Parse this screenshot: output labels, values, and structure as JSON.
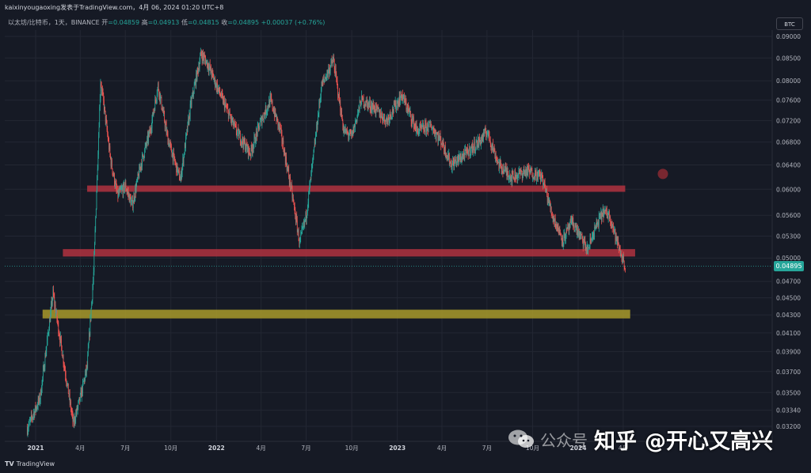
{
  "header": {
    "caption": "kaixinyougaoxing发表于TradingView.com，4月 06, 2024 01:20 UTC+8"
  },
  "legend": {
    "symbol": "以太坊/比特币，1天，BINANCE",
    "open_label": "开",
    "open_value": "=0.04859",
    "high_label": "高",
    "high_value": "=0.04913",
    "low_label": "低",
    "low_value": "=0.04815",
    "close_label": "收",
    "close_value": "=0.04895",
    "change": "+0.00037 (+0.76%)"
  },
  "currency_tag": "BTC",
  "current_price": "0.04895",
  "footer": {
    "logo_mark": "TV",
    "logo_text": "TradingView"
  },
  "watermark": {
    "wechat": "公众号",
    "prefix": "知乎",
    "at": "@开心又高兴"
  },
  "colors": {
    "background": "#161a25",
    "up": "#26a69a",
    "down": "#ef5350",
    "resistance_zone": "#b0323f",
    "support_zone": "#a89a2a"
  },
  "chart_data": {
    "type": "candlestick",
    "symbol": "以太坊/比特币",
    "interval": "1天",
    "exchange": "BINANCE",
    "ylim": [
      0.0315,
      0.0905
    ],
    "y_ticks": [
      0.09,
      0.085,
      0.08,
      0.076,
      0.072,
      0.068,
      0.064,
      0.06,
      0.056,
      0.053,
      0.05,
      0.047,
      0.045,
      0.043,
      0.041,
      0.039,
      0.037,
      0.035,
      0.0334,
      0.032
    ],
    "y_tick_labels": [
      "0.09000",
      "0.08500",
      "0.08000",
      "0.07600",
      "0.07200",
      "0.06800",
      "0.06400",
      "0.06000",
      "0.05600",
      "0.05300",
      "0.05000",
      "0.04700",
      "0.04500",
      "0.04300",
      "0.04100",
      "0.03900",
      "0.03700",
      "0.03500",
      "0.03340",
      "0.03200"
    ],
    "x_ticks": [
      "2021-01",
      "2021-04",
      "2021-07",
      "2021-10",
      "2022-01",
      "2022-04",
      "2022-07",
      "2022-10",
      "2023-01",
      "2023-04",
      "2023-07",
      "2023-10",
      "2024-01",
      "2024-04"
    ],
    "x_tick_labels": [
      "2021",
      "4月",
      "7月",
      "10月",
      "2022",
      "4月",
      "7月",
      "10月",
      "2023",
      "4月",
      "7月",
      "10月",
      "2024",
      "4月"
    ],
    "close_path": [
      [
        "2020-12-15",
        0.0318
      ],
      [
        "2021-01-10",
        0.0345
      ],
      [
        "2021-02-05",
        0.0455
      ],
      [
        "2021-02-25",
        0.0385
      ],
      [
        "2021-03-18",
        0.0322
      ],
      [
        "2021-04-01",
        0.0345
      ],
      [
        "2021-04-15",
        0.0375
      ],
      [
        "2021-04-28",
        0.048
      ],
      [
        "2021-05-12",
        0.08
      ],
      [
        "2021-05-20",
        0.074
      ],
      [
        "2021-06-01",
        0.065
      ],
      [
        "2021-06-15",
        0.059
      ],
      [
        "2021-07-01",
        0.0605
      ],
      [
        "2021-07-15",
        0.0575
      ],
      [
        "2021-08-01",
        0.064
      ],
      [
        "2021-08-20",
        0.07
      ],
      [
        "2021-09-05",
        0.079
      ],
      [
        "2021-09-25",
        0.0685
      ],
      [
        "2021-10-20",
        0.0615
      ],
      [
        "2021-11-10",
        0.075
      ],
      [
        "2021-12-01",
        0.086
      ],
      [
        "2021-12-15",
        0.0835
      ],
      [
        "2022-01-01",
        0.079
      ],
      [
        "2022-01-20",
        0.0745
      ],
      [
        "2022-02-10",
        0.07
      ],
      [
        "2022-03-10",
        0.066
      ],
      [
        "2022-04-01",
        0.072
      ],
      [
        "2022-04-20",
        0.076
      ],
      [
        "2022-05-10",
        0.07
      ],
      [
        "2022-06-01",
        0.06
      ],
      [
        "2022-06-18",
        0.052
      ],
      [
        "2022-07-01",
        0.056
      ],
      [
        "2022-07-15",
        0.065
      ],
      [
        "2022-08-01",
        0.079
      ],
      [
        "2022-08-25",
        0.0845
      ],
      [
        "2022-09-15",
        0.07
      ],
      [
        "2022-10-01",
        0.069
      ],
      [
        "2022-10-20",
        0.076
      ],
      [
        "2022-11-15",
        0.0745
      ],
      [
        "2022-12-10",
        0.072
      ],
      [
        "2023-01-10",
        0.077
      ],
      [
        "2023-02-10",
        0.07
      ],
      [
        "2023-03-10",
        0.071
      ],
      [
        "2023-04-01",
        0.068
      ],
      [
        "2023-04-20",
        0.064
      ],
      [
        "2023-05-20",
        0.066
      ],
      [
        "2023-06-15",
        0.068
      ],
      [
        "2023-07-01",
        0.07
      ],
      [
        "2023-07-25",
        0.064
      ],
      [
        "2023-08-20",
        0.062
      ],
      [
        "2023-09-20",
        0.063
      ],
      [
        "2023-10-20",
        0.062
      ],
      [
        "2023-11-10",
        0.056
      ],
      [
        "2023-12-01",
        0.0525
      ],
      [
        "2023-12-20",
        0.055
      ],
      [
        "2024-01-05",
        0.053
      ],
      [
        "2024-01-20",
        0.051
      ],
      [
        "2024-02-01",
        0.0535
      ],
      [
        "2024-02-20",
        0.0565
      ],
      [
        "2024-03-05",
        0.056
      ],
      [
        "2024-03-20",
        0.052
      ],
      [
        "2024-04-05",
        0.04895
      ]
    ],
    "zones": [
      {
        "name": "upper resistance",
        "start": "2021-04-15",
        "end": "2024-04-05",
        "y_low": 0.0596,
        "y_high": 0.0606,
        "color": "#b0323f"
      },
      {
        "name": "lower resistance",
        "start": "2021-02-25",
        "end": "2024-04-25",
        "y_low": 0.0502,
        "y_high": 0.0512,
        "color": "#b0323f"
      },
      {
        "name": "support",
        "start": "2021-01-15",
        "end": "2024-04-15",
        "y_low": 0.0426,
        "y_high": 0.0436,
        "color": "#a89a2a"
      }
    ],
    "current_price": 0.04895,
    "last_date": "2024-04-05",
    "grid": true,
    "dot_marker": {
      "date": "2024-06-20",
      "price": 0.0625
    }
  }
}
